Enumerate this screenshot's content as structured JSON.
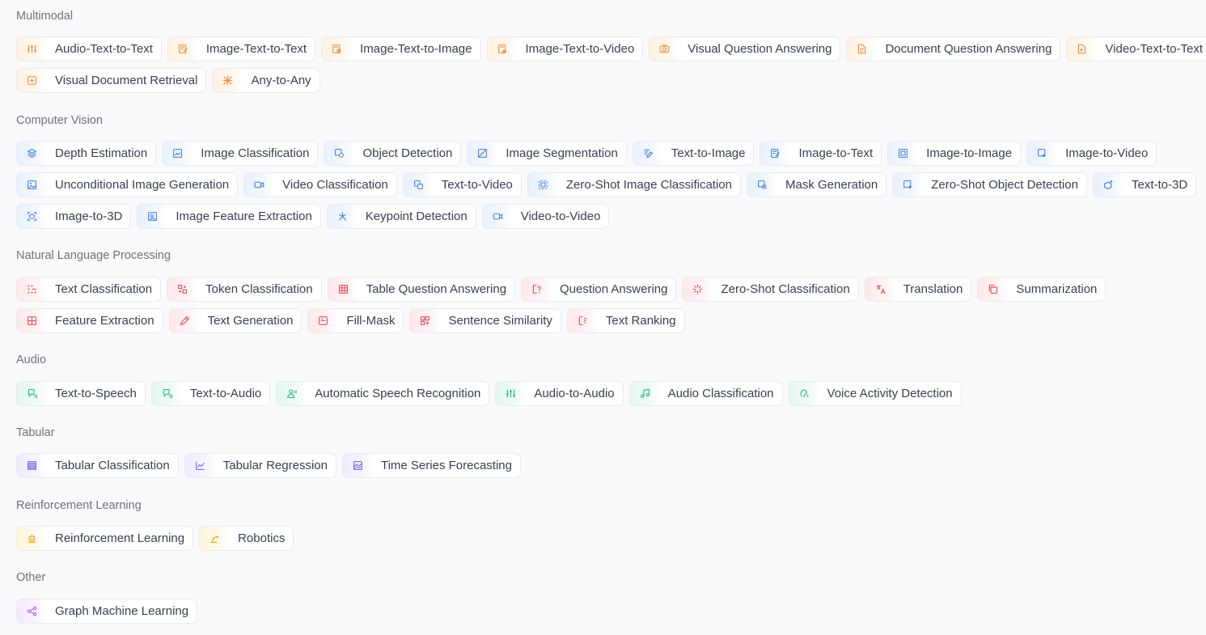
{
  "colors": {
    "orange": "#f08a2e",
    "blue": "#3b7de0",
    "red": "#e0455a",
    "green": "#1fb57f",
    "indigo": "#6c63e0",
    "yellow": "#e3a712",
    "purple": "#a855e0"
  },
  "sections": [
    {
      "title": "Multimodal",
      "color": "orange",
      "rows": [
        [
          {
            "label": "Audio-Text-to-Text",
            "icon": "sliders-icon"
          },
          {
            "label": "Image-Text-to-Text",
            "icon": "image-text-icon"
          },
          {
            "label": "Image-Text-to-Image",
            "icon": "image-text-image-icon"
          },
          {
            "label": "Image-Text-to-Video",
            "icon": "image-text-video-icon"
          },
          {
            "label": "Visual Question Answering",
            "icon": "camera-icon"
          },
          {
            "label": "Document Question Answering",
            "icon": "document-icon"
          },
          {
            "label": "Video-Text-to-Text",
            "icon": "video-document-icon"
          }
        ],
        [
          {
            "label": "Visual Document Retrieval",
            "icon": "retrieval-icon"
          },
          {
            "label": "Any-to-Any",
            "icon": "any-icon"
          }
        ]
      ]
    },
    {
      "title": "Computer Vision",
      "color": "blue",
      "rows": [
        [
          {
            "label": "Depth Estimation",
            "icon": "layers-icon"
          },
          {
            "label": "Image Classification",
            "icon": "image-classify-icon"
          },
          {
            "label": "Object Detection",
            "icon": "object-detect-icon"
          },
          {
            "label": "Image Segmentation",
            "icon": "image-segment-icon"
          },
          {
            "label": "Text-to-Image",
            "icon": "text-image-icon"
          },
          {
            "label": "Image-to-Text",
            "icon": "image-text-icon"
          },
          {
            "label": "Image-to-Image",
            "icon": "image-image-icon"
          },
          {
            "label": "Image-to-Video",
            "icon": "image-video-icon"
          }
        ],
        [
          {
            "label": "Unconditional Image Generation",
            "icon": "image-icon"
          },
          {
            "label": "Video Classification",
            "icon": "video-classify-icon"
          },
          {
            "label": "Text-to-Video",
            "icon": "text-video-icon"
          },
          {
            "label": "Zero-Shot Image Classification",
            "icon": "zero-shot-image-icon"
          },
          {
            "label": "Mask Generation",
            "icon": "mask-icon"
          },
          {
            "label": "Zero-Shot Object Detection",
            "icon": "zero-shot-object-icon"
          },
          {
            "label": "Text-to-3D",
            "icon": "cube-plus-icon"
          }
        ],
        [
          {
            "label": "Image-to-3D",
            "icon": "cube-frame-icon"
          },
          {
            "label": "Image Feature Extraction",
            "icon": "feature-extract-icon"
          },
          {
            "label": "Keypoint Detection",
            "icon": "keypoint-icon"
          },
          {
            "label": "Video-to-Video",
            "icon": "video-camera-icon"
          }
        ]
      ]
    },
    {
      "title": "Natural Language Processing",
      "color": "red",
      "rows": [
        [
          {
            "label": "Text Classification",
            "icon": "dots-icon"
          },
          {
            "label": "Token Classification",
            "icon": "token-icon"
          },
          {
            "label": "Table Question Answering",
            "icon": "table-icon"
          },
          {
            "label": "Question Answering",
            "icon": "question-icon"
          },
          {
            "label": "Zero-Shot Classification",
            "icon": "zero-shot-icon"
          },
          {
            "label": "Translation",
            "icon": "translate-icon"
          },
          {
            "label": "Summarization",
            "icon": "copy-icon"
          }
        ],
        [
          {
            "label": "Feature Extraction",
            "icon": "grid-icon"
          },
          {
            "label": "Text Generation",
            "icon": "pen-icon"
          },
          {
            "label": "Fill-Mask",
            "icon": "fill-mask-icon"
          },
          {
            "label": "Sentence Similarity",
            "icon": "similarity-icon"
          },
          {
            "label": "Text Ranking",
            "icon": "ranking-icon"
          }
        ]
      ]
    },
    {
      "title": "Audio",
      "color": "green",
      "rows": [
        [
          {
            "label": "Text-to-Speech",
            "icon": "speech-icon"
          },
          {
            "label": "Text-to-Audio",
            "icon": "speech-icon"
          },
          {
            "label": "Automatic Speech Recognition",
            "icon": "person-icon"
          },
          {
            "label": "Audio-to-Audio",
            "icon": "sliders-icon"
          },
          {
            "label": "Audio Classification",
            "icon": "music-note-icon"
          },
          {
            "label": "Voice Activity Detection",
            "icon": "voice-icon"
          }
        ]
      ]
    },
    {
      "title": "Tabular",
      "color": "indigo",
      "rows": [
        [
          {
            "label": "Tabular Classification",
            "icon": "list-icon"
          },
          {
            "label": "Tabular Regression",
            "icon": "line-chart-icon"
          },
          {
            "label": "Time Series Forecasting",
            "icon": "area-chart-icon"
          }
        ]
      ]
    },
    {
      "title": "Reinforcement Learning",
      "color": "yellow",
      "rows": [
        [
          {
            "label": "Reinforcement Learning",
            "icon": "robot-icon"
          },
          {
            "label": "Robotics",
            "icon": "robot-arm-icon"
          }
        ]
      ]
    },
    {
      "title": "Other",
      "color": "purple",
      "rows": [
        [
          {
            "label": "Graph Machine Learning",
            "icon": "graph-icon"
          }
        ]
      ]
    }
  ]
}
